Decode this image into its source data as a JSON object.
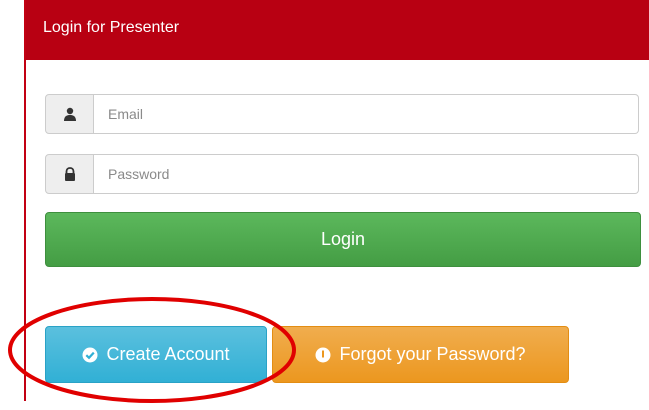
{
  "panel": {
    "title": "Login for Presenter"
  },
  "form": {
    "email_placeholder": "Email",
    "password_placeholder": "Password",
    "login_label": "Login"
  },
  "actions": {
    "create_account_label": "Create Account",
    "forgot_password_label": "Forgot your Password?"
  },
  "icons": {
    "email": "user-icon",
    "password": "lock-icon",
    "create_account": "check-circle-icon",
    "forgot_password": "info-circle-icon"
  },
  "colors": {
    "header": "#b80012",
    "login": "#5cb85c",
    "create_account": "#5bc0de",
    "forgot_password": "#f0ad4e",
    "annotation": "#e00000"
  }
}
